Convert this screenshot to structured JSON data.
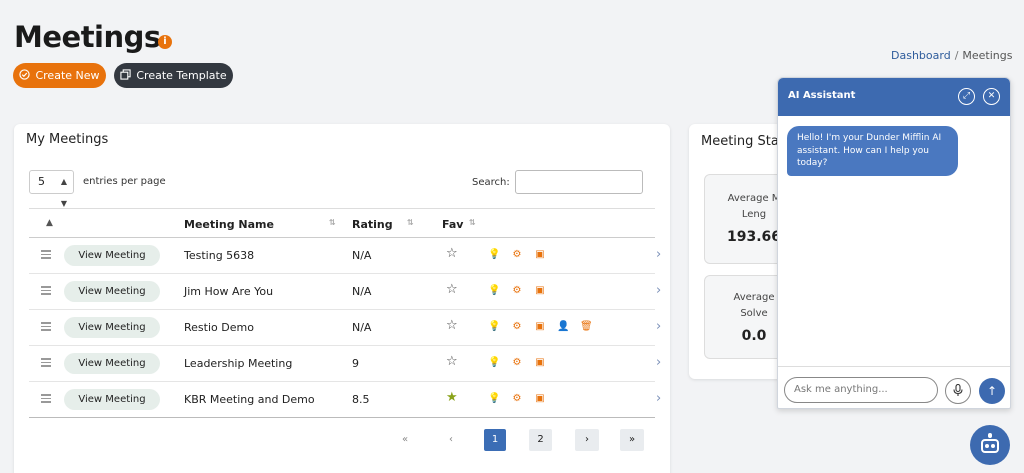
{
  "page": {
    "title": "Meetings"
  },
  "toolbar": {
    "create_new": "Create New",
    "create_template": "Create Template"
  },
  "breadcrumb": {
    "home": "Dashboard",
    "separator": "/",
    "current": "Meetings"
  },
  "meetings_card": {
    "title": "My Meetings",
    "entries_value": "5",
    "entries_label": "entries per page",
    "search_label": "Search:",
    "columns": {
      "name": "Meeting Name",
      "rating": "Rating",
      "fav": "Fav"
    },
    "view_button_label": "View Meeting",
    "rows": [
      {
        "name": "Testing 5638",
        "rating": "N/A",
        "fav": false
      },
      {
        "name": "Jim How Are You",
        "rating": "N/A",
        "fav": false
      },
      {
        "name": "Restio Demo",
        "rating": "N/A",
        "fav": false
      },
      {
        "name": "Leadership Meeting",
        "rating": "9",
        "fav": false
      },
      {
        "name": "KBR Meeting and Demo",
        "rating": "8.5",
        "fav": true
      }
    ],
    "pagination": {
      "first": "«",
      "prev": "‹",
      "pages": [
        "1",
        "2"
      ],
      "active_page": "1",
      "next": "›",
      "last": "»"
    }
  },
  "stats_card": {
    "title": "Meeting Stat",
    "stats": [
      {
        "label_line1": "Average M",
        "label_line2": "Leng",
        "value": "193.66"
      },
      {
        "label_line1": "Average",
        "label_line2": "Solve",
        "value": "0.0"
      }
    ]
  },
  "ai_assistant": {
    "title": "AI Assistant",
    "greeting": "Hello! I'm your Dunder Mifflin AI assistant. How can I help you today?",
    "input_placeholder": "Ask me anything..."
  },
  "colors": {
    "accent": "#e8720c",
    "primary": "#3d6ab0",
    "dark_button": "#333840"
  },
  "icons": [
    "info-icon",
    "check-circle-icon",
    "copy-icon",
    "drag-handle-icon",
    "star-icon",
    "lightbulb-icon",
    "gear-icon",
    "clipboard-icon",
    "add-user-icon",
    "trash-icon",
    "chevron-right-icon",
    "expand-icon",
    "close-icon",
    "microphone-icon",
    "send-arrow-icon",
    "robot-icon"
  ]
}
